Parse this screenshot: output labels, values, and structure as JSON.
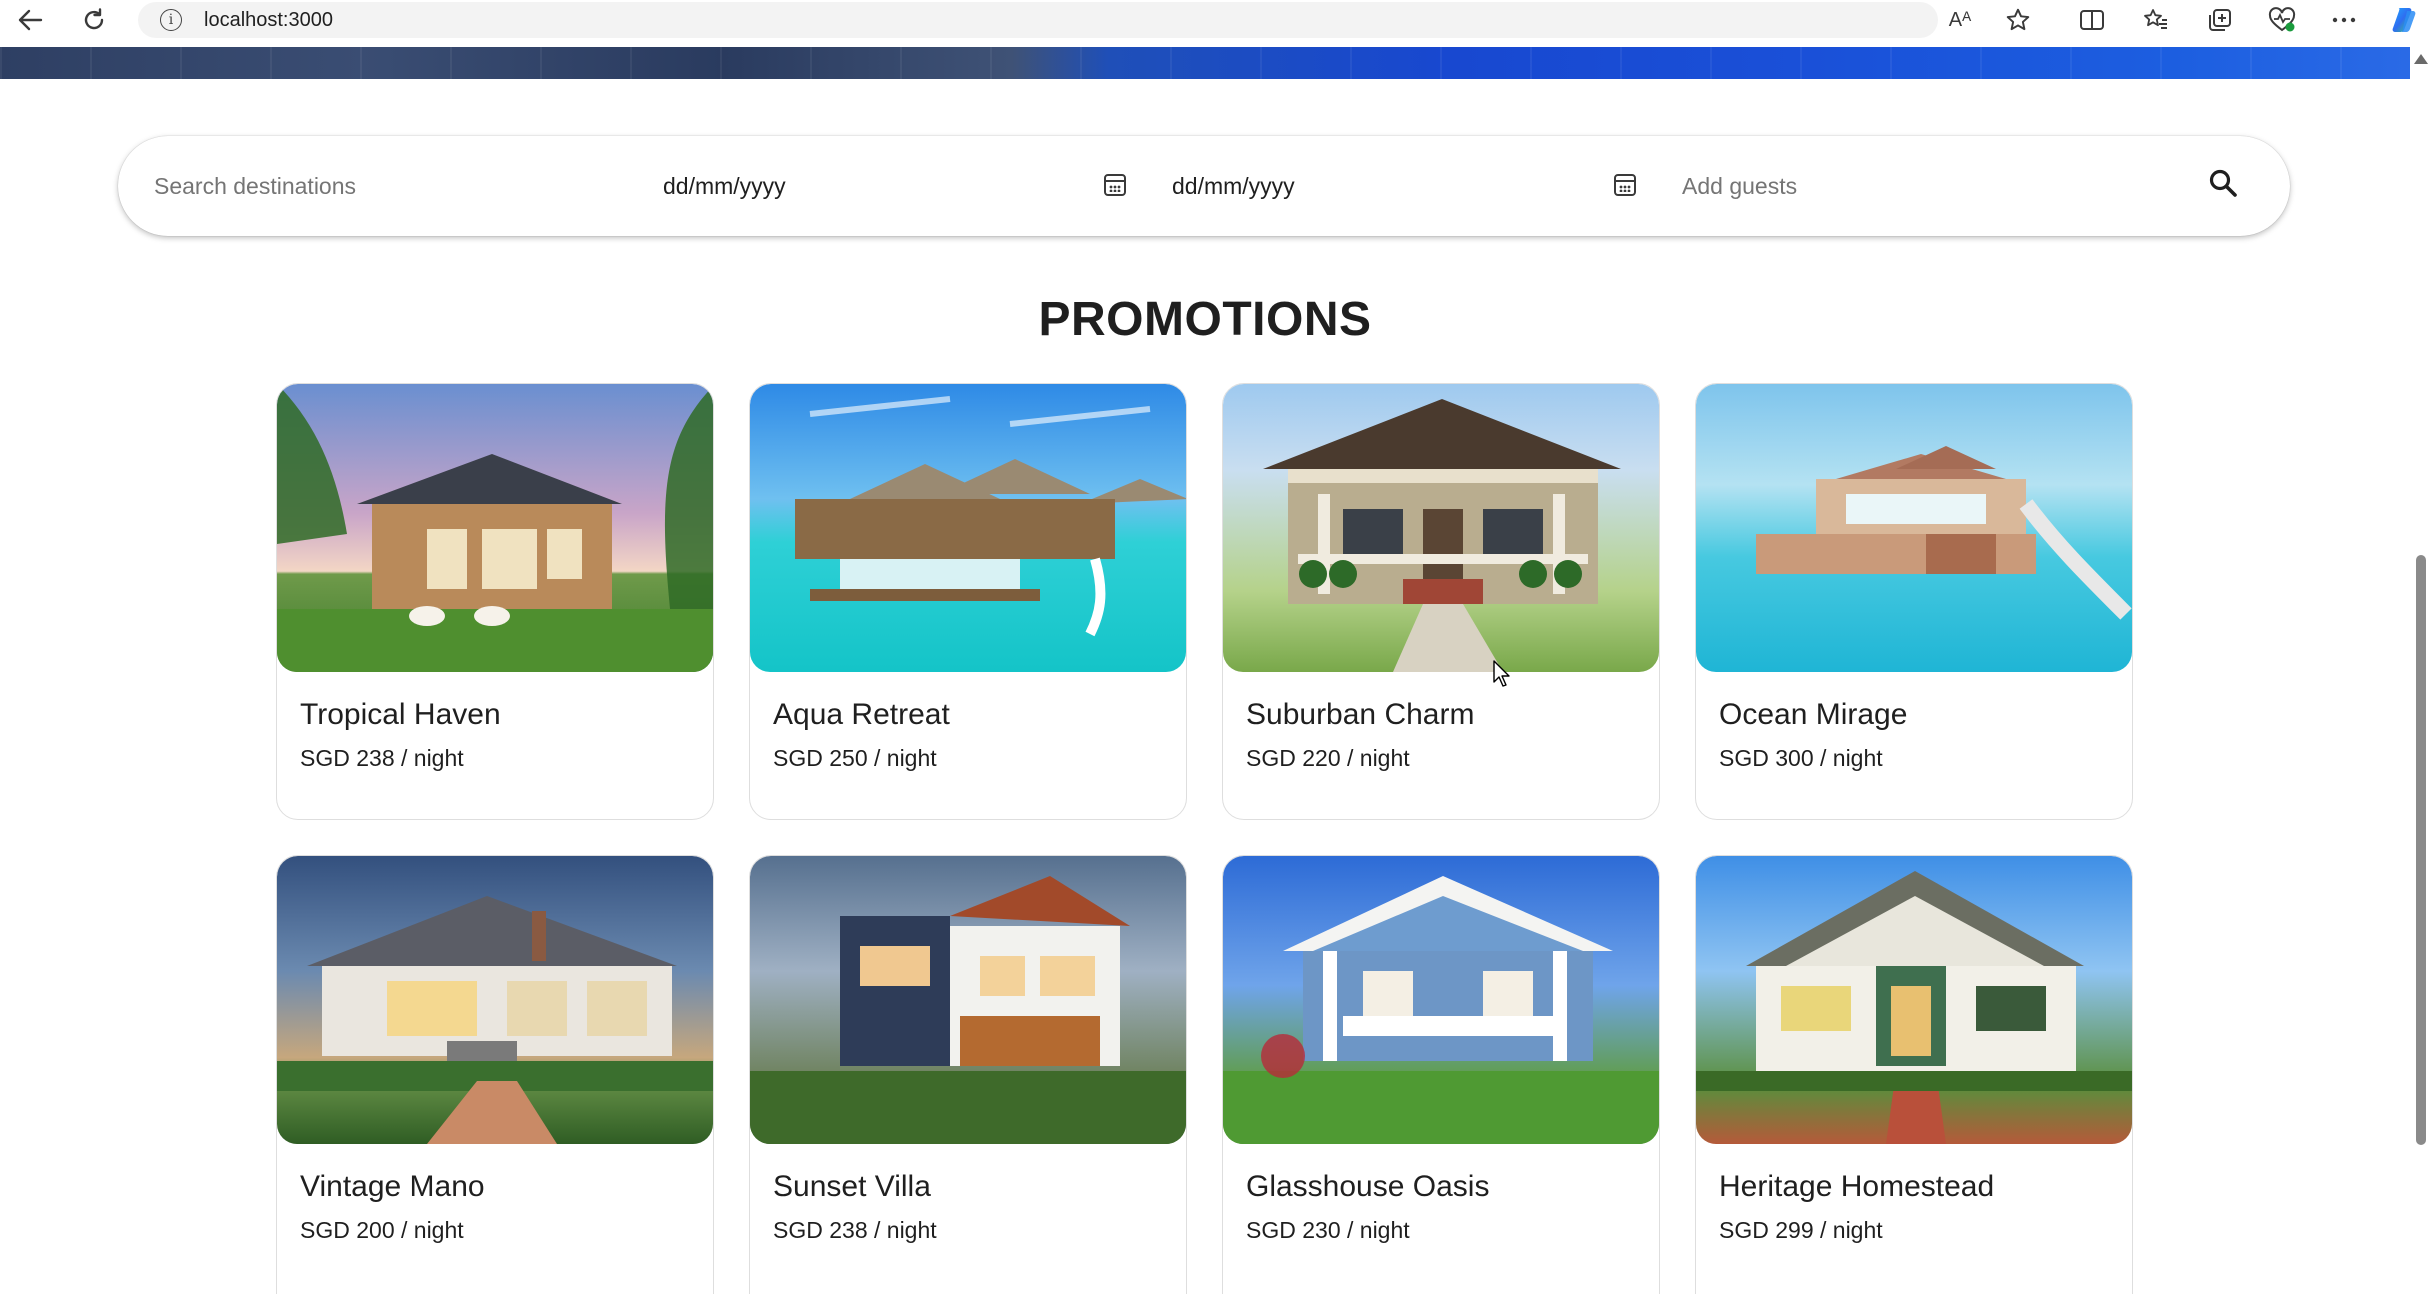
{
  "browser": {
    "url": "localhost:3000",
    "info_icon": "i",
    "read_aloud_icon": "Aᴬ"
  },
  "search": {
    "destination_placeholder": "Search destinations",
    "checkin_value": "dd/mm/yyyy",
    "checkout_value": "dd/mm/yyyy",
    "guests_placeholder": "Add guests"
  },
  "promotions": {
    "title": "PROMOTIONS",
    "items": [
      {
        "name": "Tropical Haven",
        "price": "SGD 238 / night"
      },
      {
        "name": "Aqua Retreat",
        "price": "SGD 250 / night"
      },
      {
        "name": "Suburban Charm",
        "price": "SGD 220 / night"
      },
      {
        "name": "Ocean Mirage",
        "price": "SGD 300 / night"
      },
      {
        "name": "Vintage Mano",
        "price": "SGD 200 / night"
      },
      {
        "name": "Sunset Villa",
        "price": "SGD 238 / night"
      },
      {
        "name": "Glasshouse Oasis",
        "price": "SGD 230 / night"
      },
      {
        "name": "Heritage Homestead",
        "price": "SGD 299 / night"
      }
    ]
  }
}
